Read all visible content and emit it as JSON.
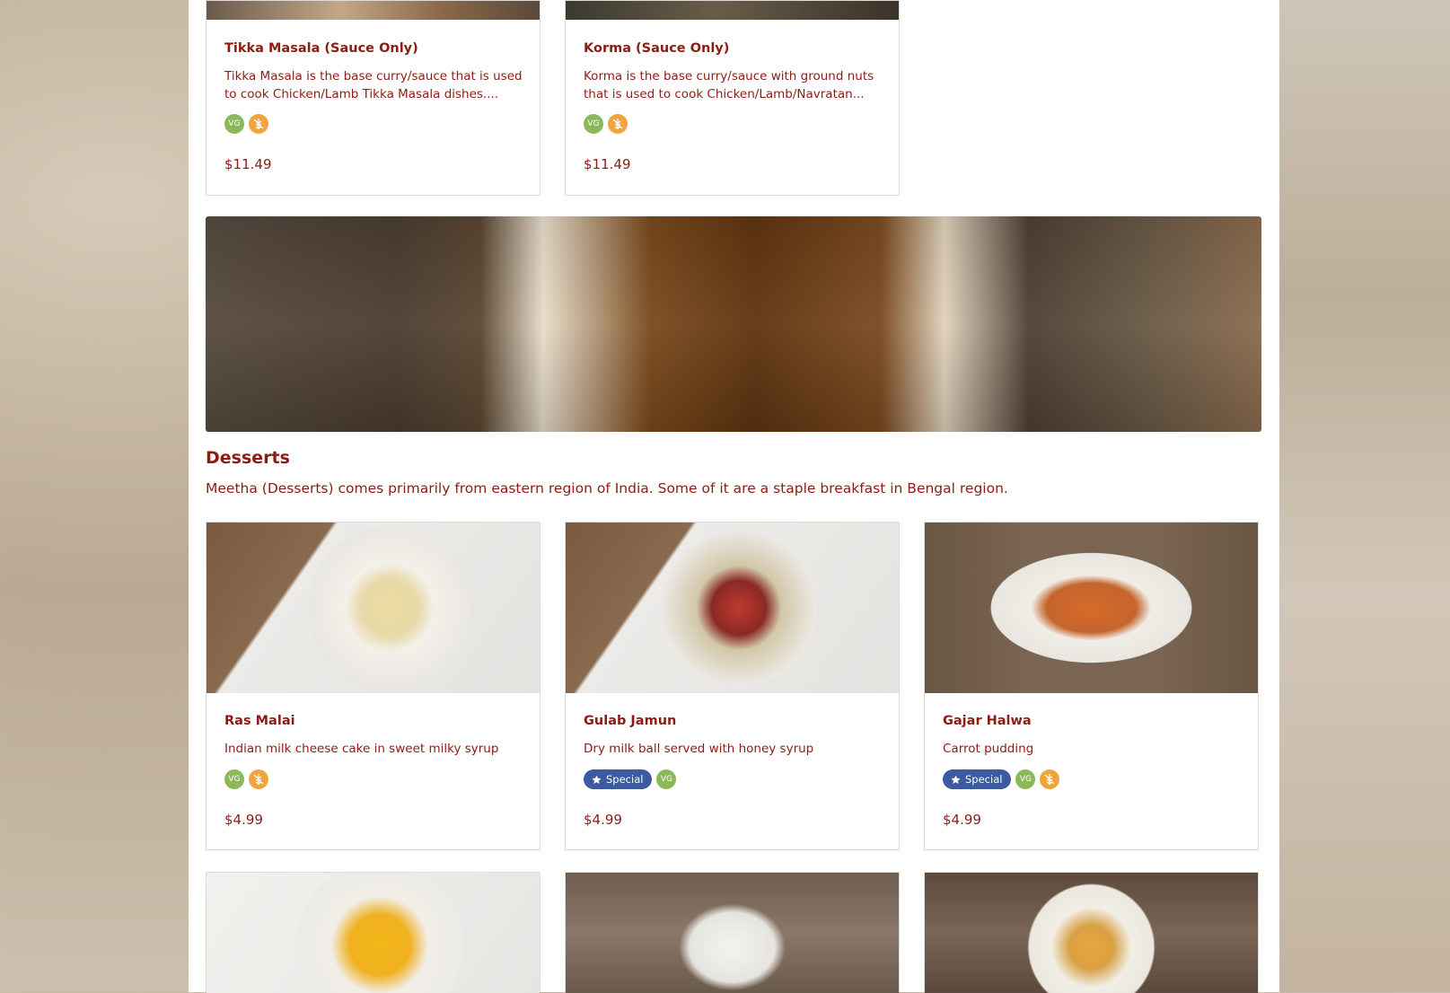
{
  "sauces": [
    {
      "name": "Tikka Masala (Sauce Only)",
      "desc": "Tikka Masala is the base curry/sauce that is used to cook Chicken/Lamb Tikka Masala dishes....",
      "price": "$11.49",
      "vg": "VG"
    },
    {
      "name": "Korma (Sauce Only)",
      "desc": "Korma is the base curry/sauce with ground nuts that is used to cook Chicken/Lamb/Navratan...",
      "price": "$11.49",
      "vg": "VG"
    }
  ],
  "desserts": {
    "title": "Desserts",
    "description": "Meetha (Desserts) comes primarily from eastern region of India. Some of it are a staple breakfast in Bengal region.",
    "items": [
      {
        "name": "Ras Malai",
        "desc": "Indian milk cheese cake in sweet milky syrup",
        "price": "$4.99",
        "vg": "VG"
      },
      {
        "name": "Gulab Jamun",
        "desc": "Dry milk ball served with honey syrup",
        "price": "$4.99",
        "special": "Special",
        "vg": "VG"
      },
      {
        "name": "Gajar Halwa",
        "desc": "Carrot pudding",
        "price": "$4.99",
        "special": "Special",
        "vg": "VG"
      }
    ]
  },
  "colors": {
    "text": "#8b1d14",
    "vegan_badge": "#8ab85a",
    "gluten_free_badge": "#f0a53c",
    "special_badge": "#3c5aa0"
  },
  "icons": {
    "vegan": "vg-icon",
    "gluten_free": "wheat-icon",
    "special": "star-icon"
  }
}
